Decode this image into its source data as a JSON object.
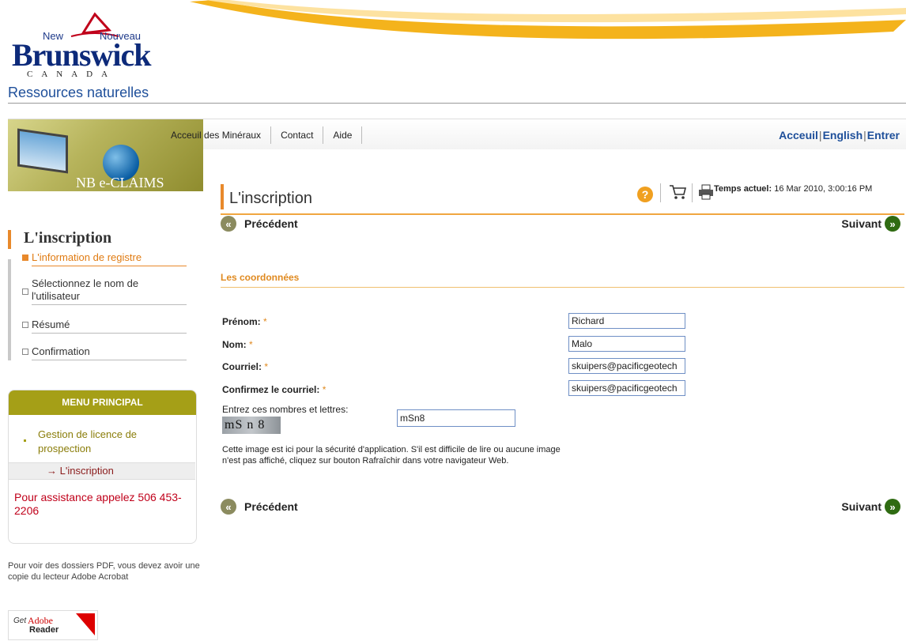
{
  "header": {
    "logo_new": "New",
    "logo_nouveau": "Nouveau",
    "logo_brunswick": "Brunswick",
    "logo_canada": "CANADA",
    "department": "Ressources naturelles"
  },
  "topnav": {
    "links": [
      "Acceuil des Minéraux",
      "Contact",
      "Aide"
    ],
    "right_home": "Acceuil",
    "right_english": "English",
    "right_login": "Entrer"
  },
  "banner": {
    "title": "NB e-CLAIMS"
  },
  "page": {
    "title": "L'inscription",
    "time_label": "Temps actuel:",
    "time_value": "16 Mar 2010, 3:00:16 PM"
  },
  "sidebar": {
    "title": "L'inscription",
    "steps": [
      {
        "label": "L'information de registre",
        "active": true
      },
      {
        "label": "Sélectionnez le nom de l'utilisateur",
        "active": false
      },
      {
        "label": "Résumé",
        "active": false
      },
      {
        "label": "Confirmation",
        "active": false
      }
    ],
    "menu_header": "MENU PRINCIPAL",
    "menu_item": "Gestion de licence de prospection",
    "menu_subitem": "→ L'inscription",
    "assistance": "Pour assistance appelez 506 453-2206",
    "pdf_note": "Pour voir des dossiers PDF, vous devez avoir une copie du lecteur Adobe Acrobat",
    "reader_get": "Get",
    "reader_adobe": "Adobe",
    "reader_name": "Reader"
  },
  "form": {
    "prev_label": "Précédent",
    "next_label": "Suivant",
    "section_title": "Les coordonnées",
    "fields": {
      "prenom_label": "Prénom:",
      "prenom_value": "Richard",
      "nom_label": "Nom:",
      "nom_value": "Malo",
      "courriel_label": "Courriel:",
      "courriel_value": "skuipers@pacificgeotech",
      "confirm_label": "Confirmez le courriel:",
      "confirm_value": "skuipers@pacificgeotech",
      "required_mark": "*"
    },
    "captcha_label": "Entrez ces nombres et lettres:",
    "captcha_image_text": "mS n 8",
    "captcha_value": "mSn8",
    "captcha_help": "Cette image est ici pour la sécurité d'application. S'il est difficile de lire ou aucune image n'est pas affiché, cliquez sur bouton Rafraîchir dans votre navigateur Web."
  },
  "colors": {
    "accent_orange": "#e8892b",
    "menu_olive": "#a59f17",
    "link_blue": "#1e4f9a",
    "next_green": "#2f6b12"
  },
  "icons": [
    "help-icon",
    "cart-icon",
    "print-icon",
    "prev-arrow-icon",
    "next-arrow-icon"
  ]
}
